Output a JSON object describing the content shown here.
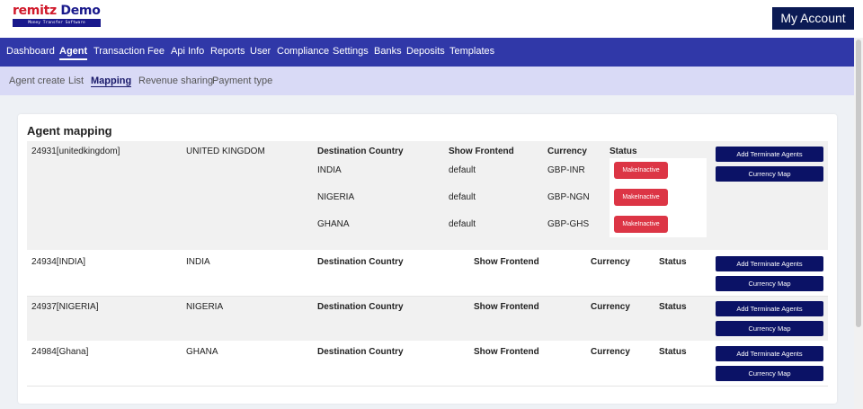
{
  "header": {
    "logo_brand": "remitz",
    "logo_word": "Demo",
    "logo_tagline": "Money Transfer Software",
    "my_account_label": "My Account"
  },
  "main_nav": [
    "Dashboard",
    "Agent",
    "Transaction",
    "Fee",
    "Api Info",
    "Reports",
    "User",
    "Compliance",
    "Settings",
    "Banks",
    "Deposits",
    "Templates"
  ],
  "main_nav_active": "Agent",
  "sub_nav": [
    "Agent create",
    "List",
    "Mapping",
    "Revenue sharing",
    "Payment type"
  ],
  "sub_nav_active": "Mapping",
  "page": {
    "title": "Agent mapping",
    "column_headers": {
      "destination_country": "Destination Country",
      "show_frontend": "Show Frontend",
      "currency": "Currency",
      "status": "Status"
    },
    "add_terminate_label": "Add Terminate Agents",
    "currency_map_label": "Currency Map",
    "make_inactive_label": "MakeInactive",
    "agents": [
      {
        "id": "24931[unitedkingdom]",
        "country": "UNITED KINGDOM",
        "mappings": [
          {
            "destination": "INDIA",
            "frontend": "default",
            "currency": "GBP-INR"
          },
          {
            "destination": "NIGERIA",
            "frontend": "default",
            "currency": "GBP-NGN"
          },
          {
            "destination": "GHANA",
            "frontend": "default",
            "currency": "GBP-GHS"
          }
        ]
      },
      {
        "id": "24934[INDIA]",
        "country": "INDIA",
        "mappings": []
      },
      {
        "id": "24937[NIGERIA]",
        "country": "NIGERIA",
        "mappings": []
      },
      {
        "id": "24984[Ghana]",
        "country": "GHANA",
        "mappings": []
      }
    ]
  },
  "colors": {
    "nav_bg": "#3038a8",
    "subnav_bg": "#d9daf6",
    "action_button": "#0b1266",
    "inactive_button": "#dc3545"
  }
}
